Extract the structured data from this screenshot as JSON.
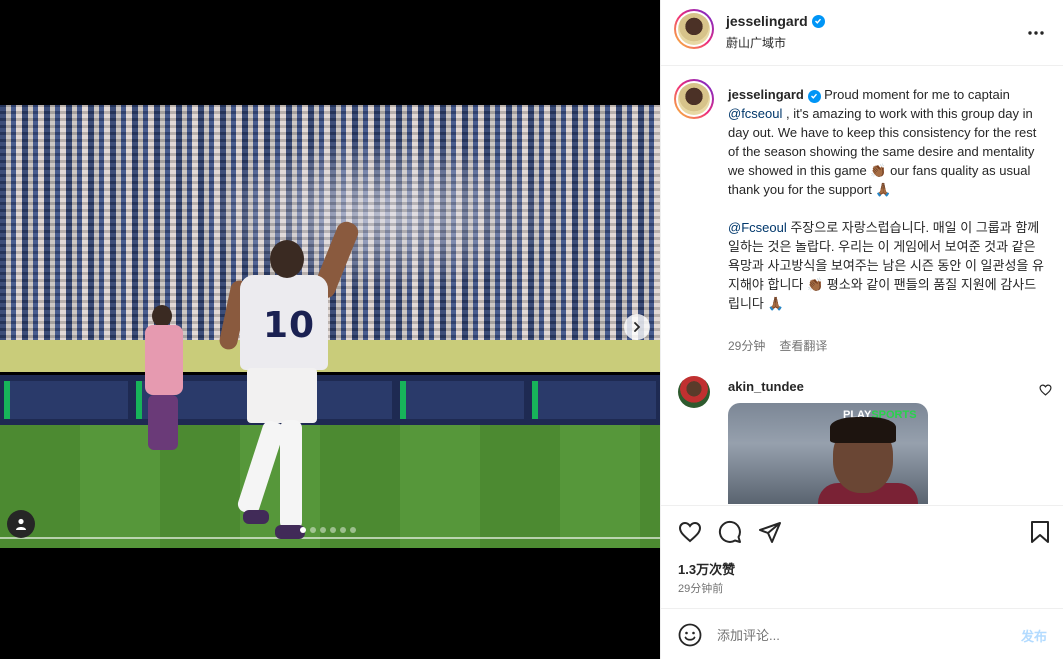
{
  "post": {
    "username": "jesselingard",
    "location": "蔚山广域市",
    "caption_en": " Proud moment for me to captain ",
    "mention_1": "@fcseoul",
    "caption_en_2": " , it's amazing to work with this group day in day out. We have to keep this consistency for the rest of the season showing the same desire and mentality we showed in this game 👏🏾 our fans quality as usual thank you for the support 🙏🏾",
    "mention_2": "@Fcseoul",
    "caption_kr": " 주장으로 자랑스럽습니다. 매일 이 그룹과 함께 일하는 것은 놀랍다. 우리는 이 게임에서 보여준 것과 같은 욕망과 사고방식을 보여주는 남은 시즌 동안 이 일관성을 유지해야 합니다 👏🏾 평소와 같이 팬들의 품질 지원에 감사드립니다 🙏🏾",
    "caption_time": "29分钟",
    "translate_label": "查看翻译",
    "likes": "1.3万次赞",
    "posted_ago": "29分钟前"
  },
  "media": {
    "jersey_number": "10",
    "slide_count": 6,
    "active_slide": 0
  },
  "reply": {
    "username": "akin_tundee",
    "gif_brand_prefix": "PLAY",
    "gif_brand_suffix": "SPORTS"
  },
  "comment_box": {
    "placeholder": "添加评论...",
    "post_label": "发布"
  },
  "icons": {
    "more": "more-icon",
    "like": "heart-icon",
    "comment": "comment-icon",
    "share": "share-icon",
    "save": "bookmark-icon",
    "emoji": "emoji-icon",
    "next": "chevron-right-icon",
    "tag": "user-tag-icon"
  },
  "colors": {
    "verified": "#0095f6",
    "mention": "#00376b",
    "muted": "#737373",
    "post_disabled": "#b3dbff"
  }
}
